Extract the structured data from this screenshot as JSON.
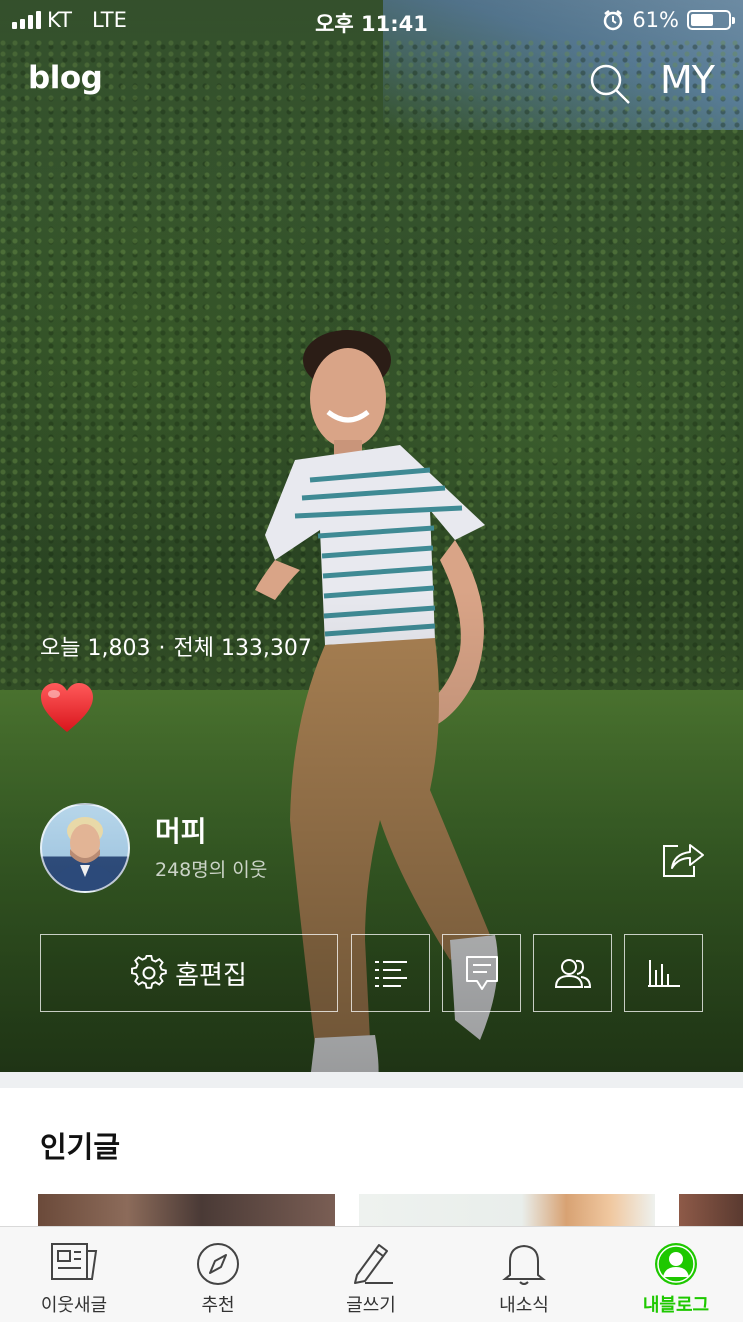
{
  "status_bar": {
    "carrier": "KT",
    "network": "LTE",
    "time": "오후 11:41",
    "battery": "61%",
    "battery_level": 0.61
  },
  "header": {
    "logo": "blog",
    "my_label": "MY",
    "icons": [
      "search-icon"
    ]
  },
  "blog": {
    "today_label": "오늘 1,803",
    "total_label": "전체 133,307",
    "separator": "·",
    "emoji": "heart-icon",
    "nickname": "머피",
    "neighbors": "248명의 이웃"
  },
  "actions": {
    "home_edit": "홈편집",
    "icons": [
      "settings-icon",
      "list-icon",
      "post-icon",
      "neighbors-icon",
      "stats-icon"
    ]
  },
  "popular": {
    "title": "인기글"
  },
  "tabs": [
    {
      "label": "이웃새글",
      "icon": "newspaper-icon",
      "active": false
    },
    {
      "label": "추천",
      "icon": "compass-icon",
      "active": false
    },
    {
      "label": "글쓰기",
      "icon": "pencil-icon",
      "active": false
    },
    {
      "label": "내소식",
      "icon": "bell-icon",
      "active": false
    },
    {
      "label": "내블로그",
      "icon": "profile-icon",
      "active": true
    }
  ],
  "colors": {
    "accent": "#1ec800",
    "tab_text": "#333333",
    "white": "#ffffff"
  }
}
